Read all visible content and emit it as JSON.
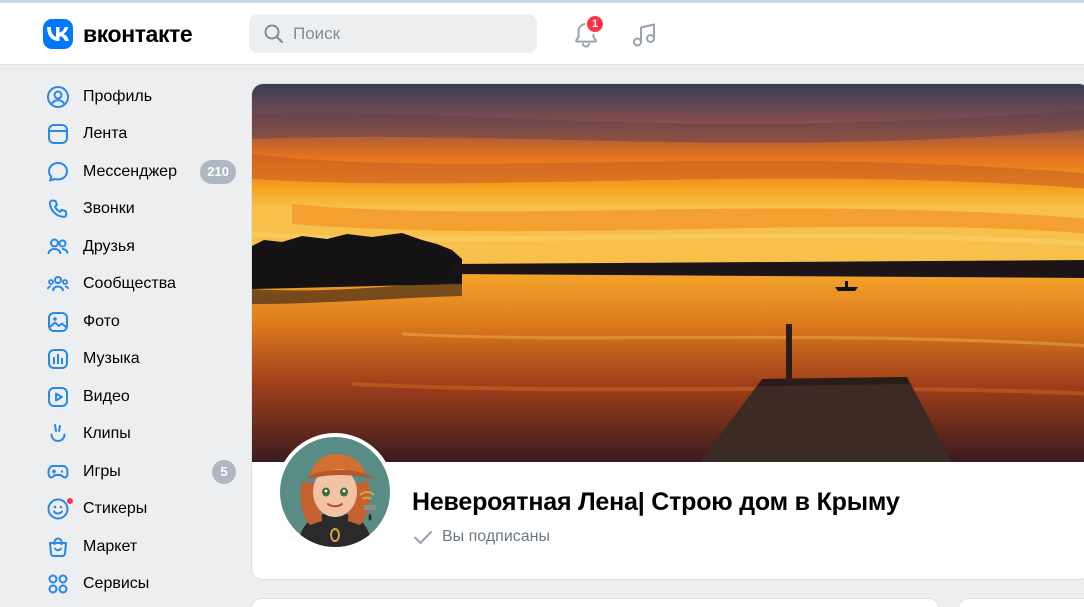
{
  "header": {
    "logo_text": "вконтакте",
    "search_placeholder": "Поиск",
    "notifications_count": "1"
  },
  "sidebar": {
    "items": [
      {
        "label": "Профиль",
        "icon": "profile-icon"
      },
      {
        "label": "Лента",
        "icon": "feed-icon"
      },
      {
        "label": "Мессенджер",
        "icon": "messenger-icon",
        "count": "210"
      },
      {
        "label": "Звонки",
        "icon": "calls-icon"
      },
      {
        "label": "Друзья",
        "icon": "friends-icon"
      },
      {
        "label": "Сообщества",
        "icon": "communities-icon"
      },
      {
        "label": "Фото",
        "icon": "photo-icon"
      },
      {
        "label": "Музыка",
        "icon": "music-icon"
      },
      {
        "label": "Видео",
        "icon": "video-icon"
      },
      {
        "label": "Клипы",
        "icon": "clips-icon"
      },
      {
        "label": "Игры",
        "icon": "games-icon",
        "count": "5"
      },
      {
        "label": "Стикеры",
        "icon": "stickers-icon"
      },
      {
        "label": "Маркет",
        "icon": "market-icon"
      },
      {
        "label": "Сервисы",
        "icon": "services-icon"
      }
    ]
  },
  "profile": {
    "name": "Невероятная Лена| Строю дом в Крыму",
    "status": "Вы подписаны"
  },
  "colors": {
    "accent": "#0077ff",
    "badge": "#ff3347",
    "counter": "#aeb7c2",
    "icon": "#2688eb"
  }
}
